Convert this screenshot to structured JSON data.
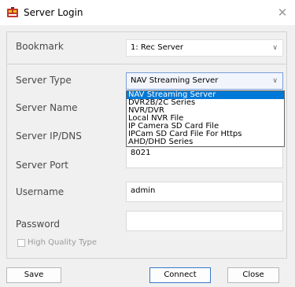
{
  "window": {
    "title": "Server Login",
    "close_glyph": "✕",
    "icon": "app-logo-icon"
  },
  "bookmark": {
    "label": "Bookmark",
    "value": "1: Rec Server"
  },
  "server_type": {
    "label": "Server Type",
    "value": "NAV Streaming Server",
    "options": [
      "NAV Streaming Server",
      "DVR2B/2C Series",
      "NVR/DVR",
      "Local NVR File",
      "IP Camera SD Card File",
      "IPCam SD Card File For Https",
      "AHD/DHD Series"
    ]
  },
  "server_name": {
    "label": "Server Name"
  },
  "server_ip": {
    "label": "Server IP/DNS"
  },
  "server_port": {
    "label": "Server Port",
    "value": "8021"
  },
  "username": {
    "label": "Username",
    "value": "admin"
  },
  "password": {
    "label": "Password",
    "value": ""
  },
  "high_quality": {
    "label": "High Quality Type",
    "checked": false
  },
  "buttons": {
    "save": "Save",
    "connect": "Connect",
    "close": "Close"
  },
  "colors": {
    "selection": "#0078d7",
    "focus_border": "#3a78c8"
  }
}
